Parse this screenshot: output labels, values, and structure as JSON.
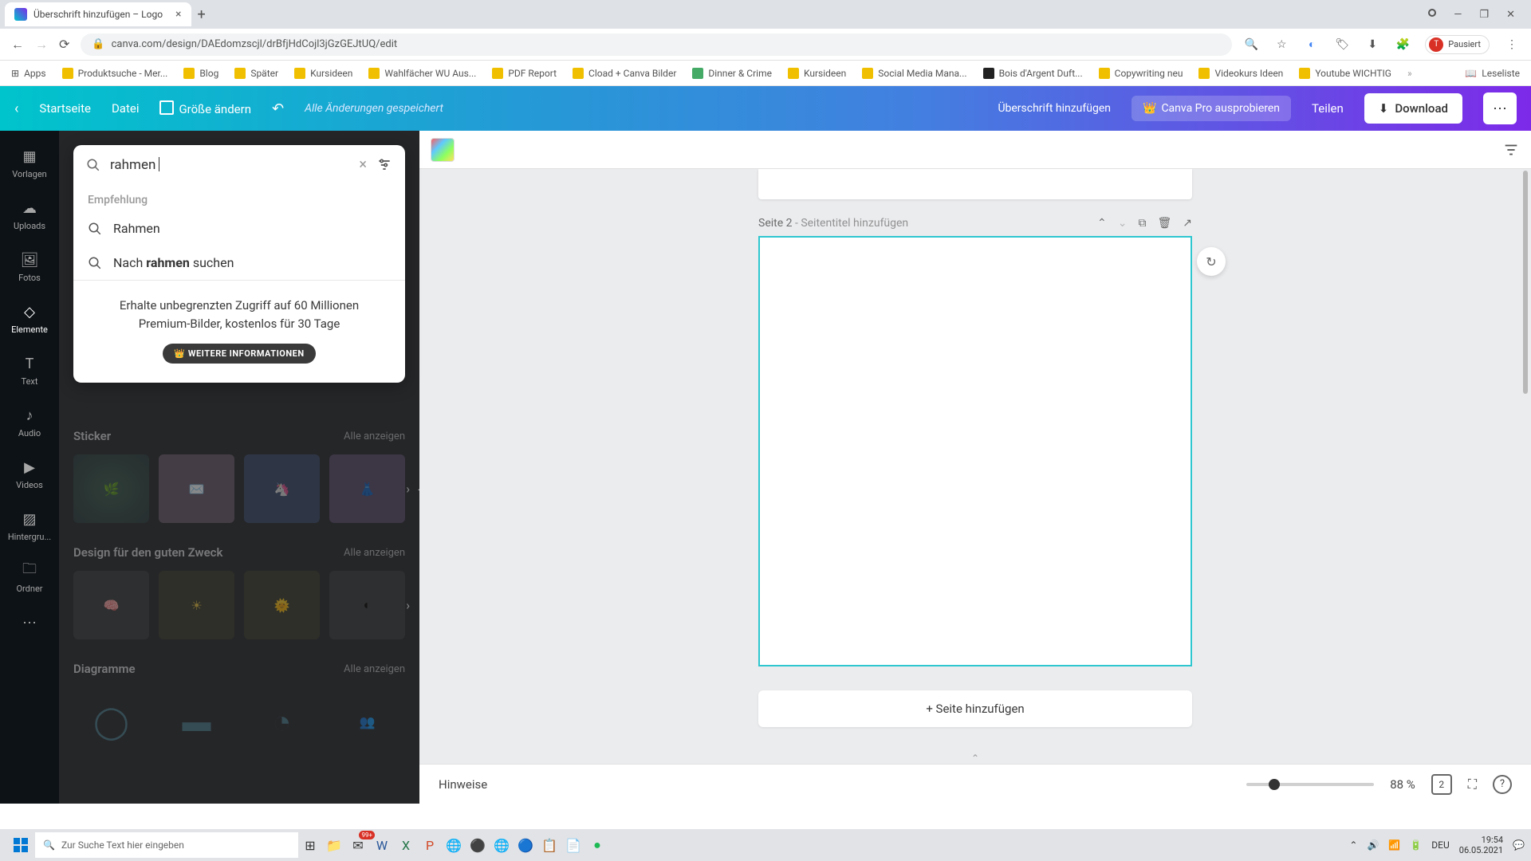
{
  "browser": {
    "tab_title": "Überschrift hinzufügen – Logo",
    "url": "canva.com/design/DAEdomzscjl/drBfjHdCojl3jGzGEJtUQ/edit",
    "user_status": "Pausiert",
    "window_controls": [
      "minimize",
      "maximize",
      "close"
    ]
  },
  "bookmarks": {
    "apps": "Apps",
    "items": [
      "Produktsuche - Mer...",
      "Blog",
      "Später",
      "Kursideen",
      "Wahlfächer WU Aus...",
      "PDF Report",
      "Cload + Canva Bilder",
      "Dinner & Crime",
      "Kursideen",
      "Social Media Mana...",
      "Bois d'Argent Duft...",
      "Copywriting neu",
      "Videokurs Ideen",
      "Youtube WICHTIG"
    ],
    "reading_list": "Leseliste"
  },
  "header": {
    "home": "Startseite",
    "file": "Datei",
    "resize": "Größe ändern",
    "saved": "Alle Änderungen gespeichert",
    "title": "Überschrift hinzufügen",
    "pro": "Canva Pro ausprobieren",
    "share": "Teilen",
    "download": "Download"
  },
  "sidebar": {
    "items": [
      {
        "label": "Vorlagen",
        "icon": "grid"
      },
      {
        "label": "Uploads",
        "icon": "cloud"
      },
      {
        "label": "Fotos",
        "icon": "photo"
      },
      {
        "label": "Elemente",
        "icon": "shapes"
      },
      {
        "label": "Text",
        "icon": "text"
      },
      {
        "label": "Audio",
        "icon": "audio"
      },
      {
        "label": "Videos",
        "icon": "video"
      },
      {
        "label": "Hintergru...",
        "icon": "hatch"
      },
      {
        "label": "Ordner",
        "icon": "folder"
      },
      {
        "label": "",
        "icon": "more"
      }
    ]
  },
  "search": {
    "query": "rahmen",
    "rec_label": "Empfehlung",
    "suggestions": {
      "exact": "Rahmen",
      "search_pre": "Nach ",
      "search_mid": "rahmen",
      "search_post": " suchen"
    },
    "premium": {
      "text": "Erhalte unbegrenzten Zugriff auf 60 Millionen Premium-Bilder, kostenlos für 30 Tage",
      "cta": "WEITERE INFORMATIONEN"
    }
  },
  "panel": {
    "sections": [
      {
        "title": "Sticker",
        "see_all": "Alle anzeigen"
      },
      {
        "title": "Design für den guten Zweck",
        "see_all": "Alle anzeigen"
      },
      {
        "title": "Diagramme",
        "see_all": "Alle anzeigen"
      }
    ]
  },
  "canvas": {
    "page_label_pre": "Seite 2",
    "page_label_post": " - Seitentitel hinzufügen",
    "add_page": "+ Seite hinzufügen"
  },
  "bottom": {
    "notes": "Hinweise",
    "zoom": "88 %",
    "page_count": "2"
  },
  "taskbar": {
    "search_placeholder": "Zur Suche Text hier eingeben",
    "badge": "99+",
    "lang": "DEU",
    "time": "19:54",
    "date": "06.05.2021"
  }
}
